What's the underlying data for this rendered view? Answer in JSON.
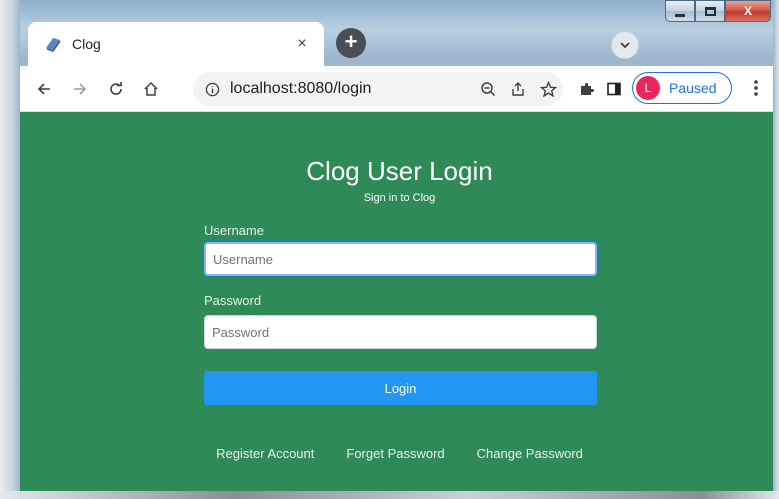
{
  "window": {
    "minimize_icon": "minimize-icon",
    "maximize_icon": "maximize-icon",
    "close_icon": "close-icon",
    "close_label": "X"
  },
  "tab": {
    "title": "Clog",
    "close_label": "×",
    "new_tab_label": "+"
  },
  "toolbar": {
    "url": "localhost:8080/login",
    "profile_initial": "L",
    "profile_label": "Paused"
  },
  "page": {
    "title": "Clog User Login",
    "subtitle": "Sign in to Clog",
    "username_label": "Username",
    "username_placeholder": "Username",
    "password_label": "Password",
    "password_placeholder": "Password",
    "login_label": "Login",
    "links": [
      "Register Account",
      "Forget Password",
      "Change Password"
    ]
  },
  "colors": {
    "page_background": "#2e8b57",
    "login_button": "#2196f3",
    "profile_accent": "#1a73e8",
    "avatar": "#e8275f"
  }
}
